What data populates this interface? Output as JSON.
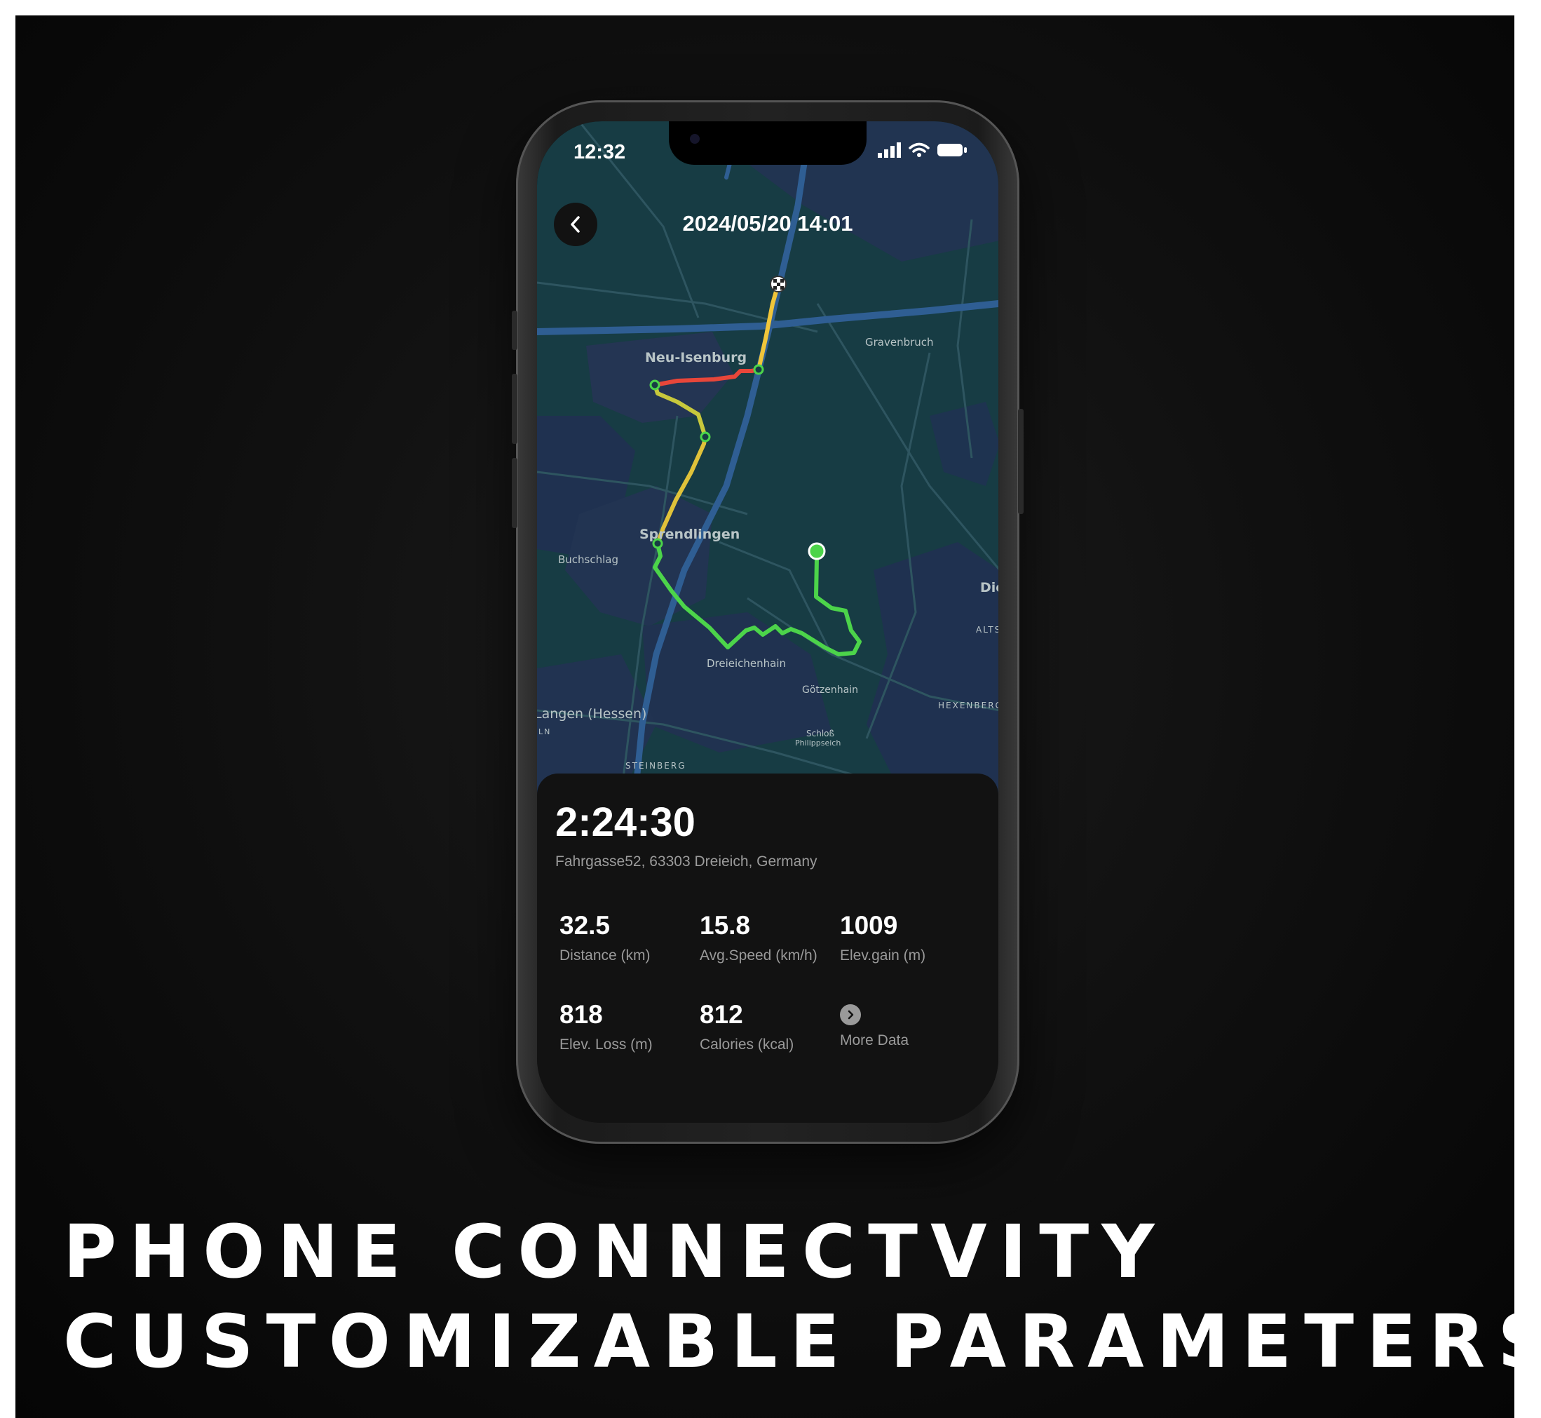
{
  "phone": {
    "status_time": "12:32",
    "title": "2024/05/20 14:01"
  },
  "map": {
    "labels": [
      {
        "name": "map-label-neu-isenburg",
        "text": "Neu-Isenburg"
      },
      {
        "name": "map-label-gravenbruch",
        "text": "Gravenbruch"
      },
      {
        "name": "map-label-sprendlingen",
        "text": "Sprendlingen"
      },
      {
        "name": "map-label-buchschlag",
        "text": "Buchschlag"
      },
      {
        "name": "map-label-die",
        "text": "Die"
      },
      {
        "name": "map-label-alts",
        "text": "ALTS"
      },
      {
        "name": "map-label-dreieichenhain",
        "text": "Dreieichenhain"
      },
      {
        "name": "map-label-gotzenhain",
        "text": "Götzenhain"
      },
      {
        "name": "map-label-langen",
        "text": "Langen (Hessen)"
      },
      {
        "name": "map-label-hexenberg",
        "text": "HEXENBERG"
      },
      {
        "name": "map-label-schloss",
        "text": "Schloß"
      },
      {
        "name": "map-label-philippseich",
        "text": "Philippseich"
      },
      {
        "name": "map-label-steinberg",
        "text": "STEINBERG"
      },
      {
        "name": "map-label-ln",
        "text": "LN"
      }
    ]
  },
  "summary": {
    "duration": "2:24:30",
    "address": "Fahrgasse52, 63303 Dreieich, Germany"
  },
  "stats": {
    "distance": {
      "value": "32.5",
      "label": "Distance (km)"
    },
    "avg_speed": {
      "value": "15.8",
      "label": "Avg.Speed (km/h)"
    },
    "elev_gain": {
      "value": "1009",
      "label": "Elev.gain (m)"
    },
    "elev_loss": {
      "value": "818",
      "label": "Elev. Loss (m)"
    },
    "calories": {
      "value": "812",
      "label": "Calories (kcal)"
    },
    "more": {
      "label": "More Data"
    }
  },
  "headline": {
    "line1": "PHONE CONNECTVITY",
    "line2": "CUSTOMIZABLE PARAMETERS"
  },
  "colors": {
    "route_start": "#4cd44a",
    "route_mid": "#f0c53a",
    "route_hot": "#e8463a",
    "map_bg": "#173c44"
  }
}
